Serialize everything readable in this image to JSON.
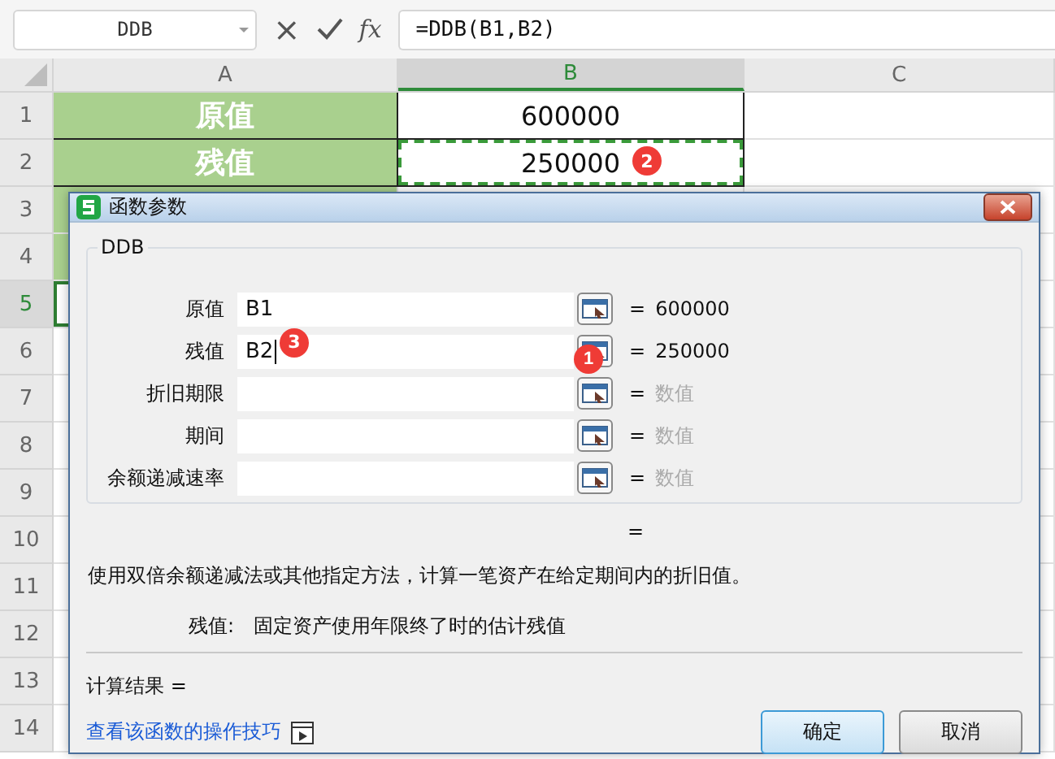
{
  "formula_bar": {
    "name_box": "DDB",
    "cancel": "×",
    "fx": "fx",
    "formula": "=DDB(B1,B2)"
  },
  "columns": [
    {
      "label": "A",
      "selected": false
    },
    {
      "label": "B",
      "selected": true
    },
    {
      "label": "C",
      "selected": false
    }
  ],
  "rows": [
    {
      "number": "1",
      "selected": false,
      "a": "原值",
      "a_filled": true,
      "b": "600000",
      "b_marquee": false
    },
    {
      "number": "2",
      "selected": false,
      "a": "残值",
      "a_filled": true,
      "b": "250000",
      "b_marquee": true,
      "badge": "2"
    },
    {
      "number": "3",
      "selected": false,
      "a_filled": true
    },
    {
      "number": "4",
      "selected": false,
      "a_filled": true
    },
    {
      "number": "5",
      "selected": true,
      "a_filled": false
    },
    {
      "number": "6",
      "selected": false,
      "a_filled": false
    },
    {
      "number": "7",
      "selected": false,
      "a_filled": false
    },
    {
      "number": "8",
      "selected": false,
      "a_filled": false
    },
    {
      "number": "9",
      "selected": false,
      "a_filled": false
    },
    {
      "number": "10",
      "selected": false,
      "a_filled": false
    },
    {
      "number": "11",
      "selected": false,
      "a_filled": false
    },
    {
      "number": "12",
      "selected": false,
      "a_filled": false
    },
    {
      "number": "13",
      "selected": false,
      "a_filled": false
    },
    {
      "number": "14",
      "selected": false,
      "a_filled": false
    }
  ],
  "dialog": {
    "title": "函数参数",
    "group": "DDB",
    "args": [
      {
        "label": "原值",
        "value": "B1",
        "equals": "=",
        "result": "600000",
        "placeholder_result": false
      },
      {
        "label": "残值",
        "value": "B2",
        "equals": "=",
        "result": "250000",
        "placeholder_result": false,
        "focused": true,
        "badge": "3",
        "button_badge": "1"
      },
      {
        "label": "折旧期限",
        "equals": "=",
        "result": "数值",
        "placeholder_result": true
      },
      {
        "label": "期间",
        "equals": "=",
        "result": "数值",
        "placeholder_result": true
      },
      {
        "label": "余额递减速率",
        "equals": "=",
        "result": "数值",
        "placeholder_result": true
      }
    ],
    "formula_result": "=",
    "description": "使用双倍余额递减法或其他指定方法，计算一笔资产在给定期间内的折旧值。",
    "arg_name": "残值:",
    "arg_help": "固定资产使用年限终了时的估计残值",
    "calc_label": "计算结果  =",
    "link": "查看该函数的操作技巧",
    "buttons": [
      {
        "label": "确定",
        "default": true
      },
      {
        "label": "取消",
        "default": false
      }
    ]
  }
}
